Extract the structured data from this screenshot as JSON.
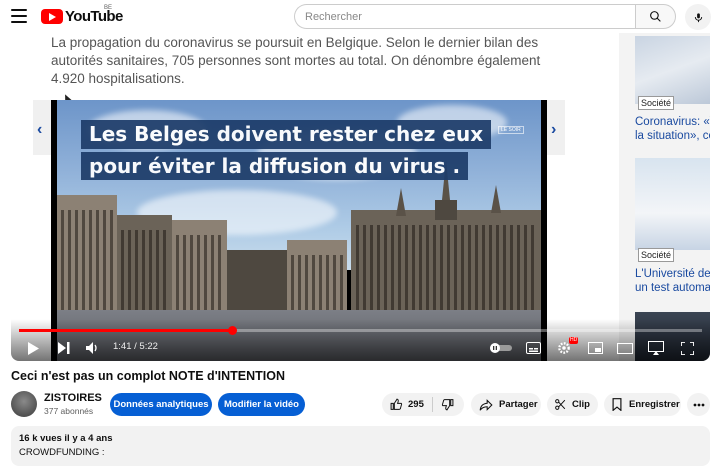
{
  "header": {
    "logo_text": "YouTube",
    "region": "BE",
    "search_placeholder": "Recherch­er"
  },
  "article": {
    "text": "La propagation du coronavirus se poursuit en Belgique. Selon le dernier bilan des autorités sanitaires, 705 personnes sont mortes au total. On dénombre également 4.920 hospitalisations."
  },
  "video_overlay": {
    "line1": "Les Belges doivent rester chez eux",
    "line2": "pour éviter la diffusion du virus ."
  },
  "side_articles": [
    {
      "tag": "Société",
      "title_line1": "Coronavirus: «V",
      "title_line2": "la situation», ce"
    },
    {
      "tag": "Société",
      "title_line1": "L'Université de l",
      "title_line2": "un test automat"
    }
  ],
  "player": {
    "time_current": "1:41",
    "time_total": "5:22",
    "progress": 0.313
  },
  "video": {
    "title": "Ceci n'est pas un complot NOTE d'INTENTION",
    "channel": "ZISTOIRES",
    "subscribers": "377 abonnés"
  },
  "actions": {
    "analytics_label": "Données analytiques",
    "edit_label": "Modifier la vidéo",
    "likes": "295",
    "share_label": "Partager",
    "clip_label": "Clip",
    "save_label": "Enregistrer"
  },
  "description": {
    "meta": "16 k vues  il y a 4 ans",
    "first_line": "CROWDFUNDING :"
  }
}
